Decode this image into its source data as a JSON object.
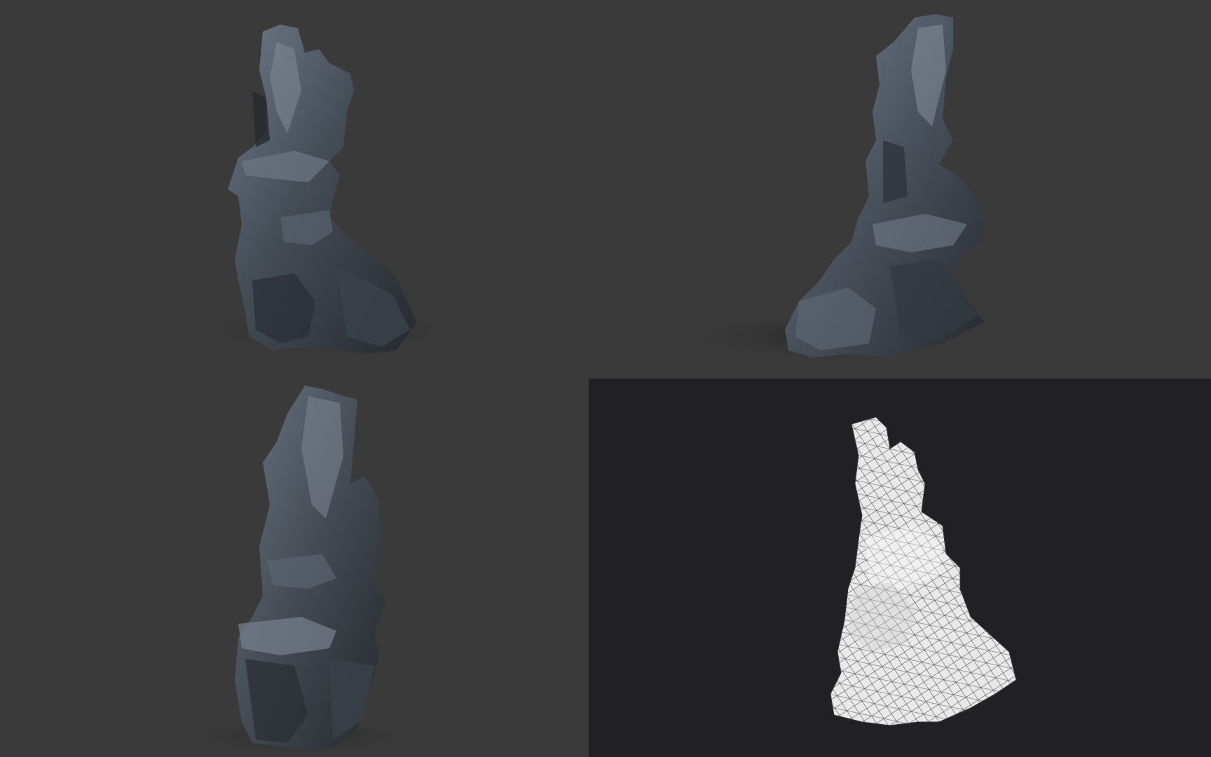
{
  "scene": {
    "description_free": true,
    "panels": [
      {
        "id": "top-left",
        "kind": "render",
        "subject": "rock-spire"
      },
      {
        "id": "top-right",
        "kind": "render",
        "subject": "rock-spire"
      },
      {
        "id": "bottom-left",
        "kind": "render",
        "subject": "rock-spire"
      },
      {
        "id": "bottom-right",
        "kind": "wireframe",
        "subject": "rock-spire-wireframe"
      }
    ],
    "colors": {
      "background": "#3a3a3b",
      "wireframe_background": "#212123",
      "rock_dark": "#2a2f36",
      "rock_mid": "#4a525c",
      "rock_light": "#7c8794",
      "wire_fill": "#e9e9e9",
      "wire_line": "#3c3c3c"
    }
  }
}
